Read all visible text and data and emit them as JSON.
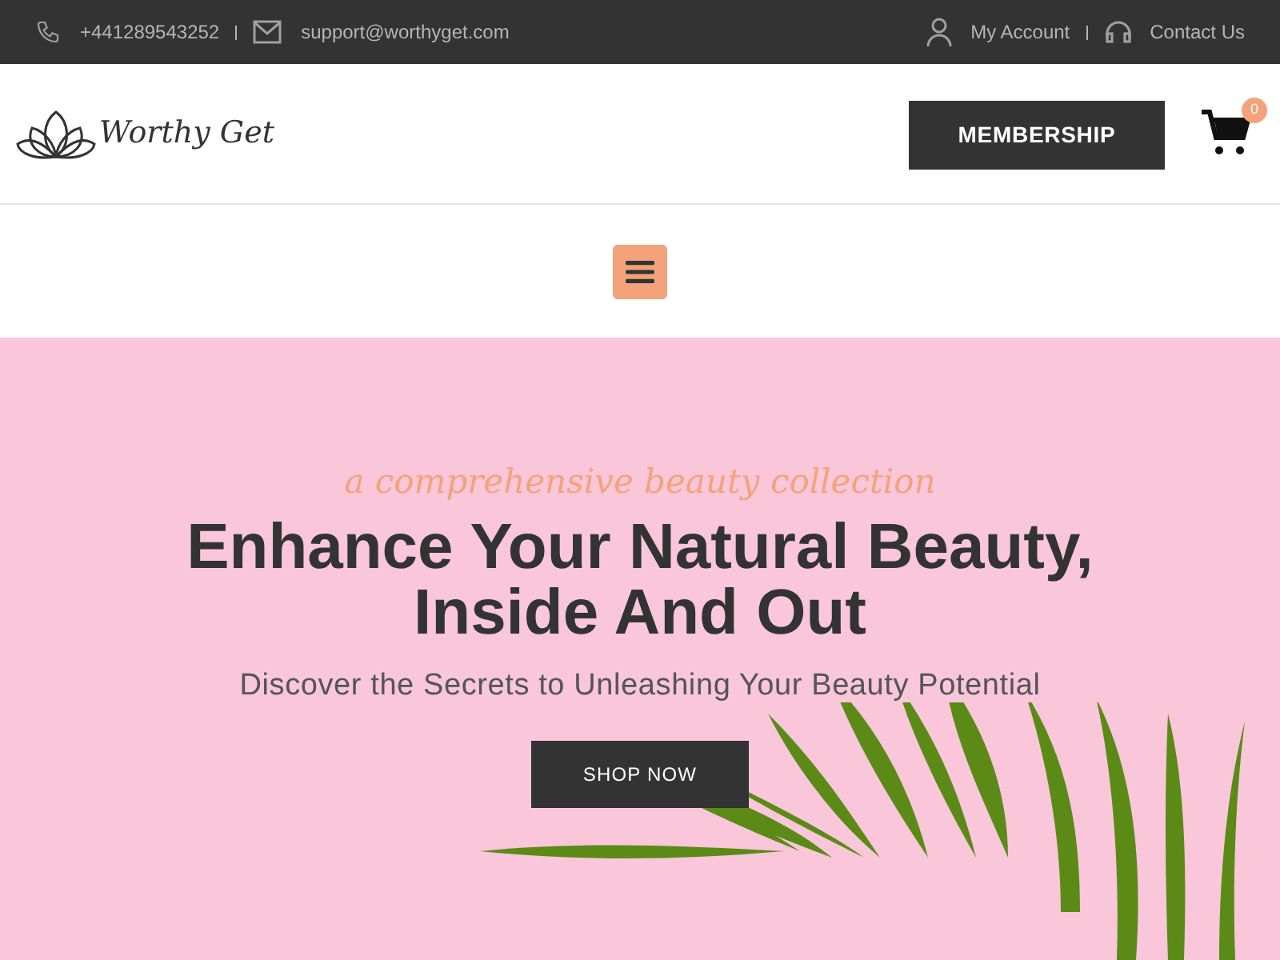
{
  "top_bar": {
    "phone": "+441289543252",
    "email": "support@worthyget.com",
    "account": "My Account",
    "contact": "Contact Us"
  },
  "header": {
    "logo_text": "Worthy Get",
    "membership_button": "MEMBERSHIP",
    "cart_count": "0"
  },
  "hero": {
    "tagline": "a comprehensive beauty collection",
    "title": "Enhance Your Natural Beauty, Inside And Out",
    "subtitle": "Discover the Secrets to Unleashing Your Beauty Potential",
    "button": "SHOP NOW"
  }
}
